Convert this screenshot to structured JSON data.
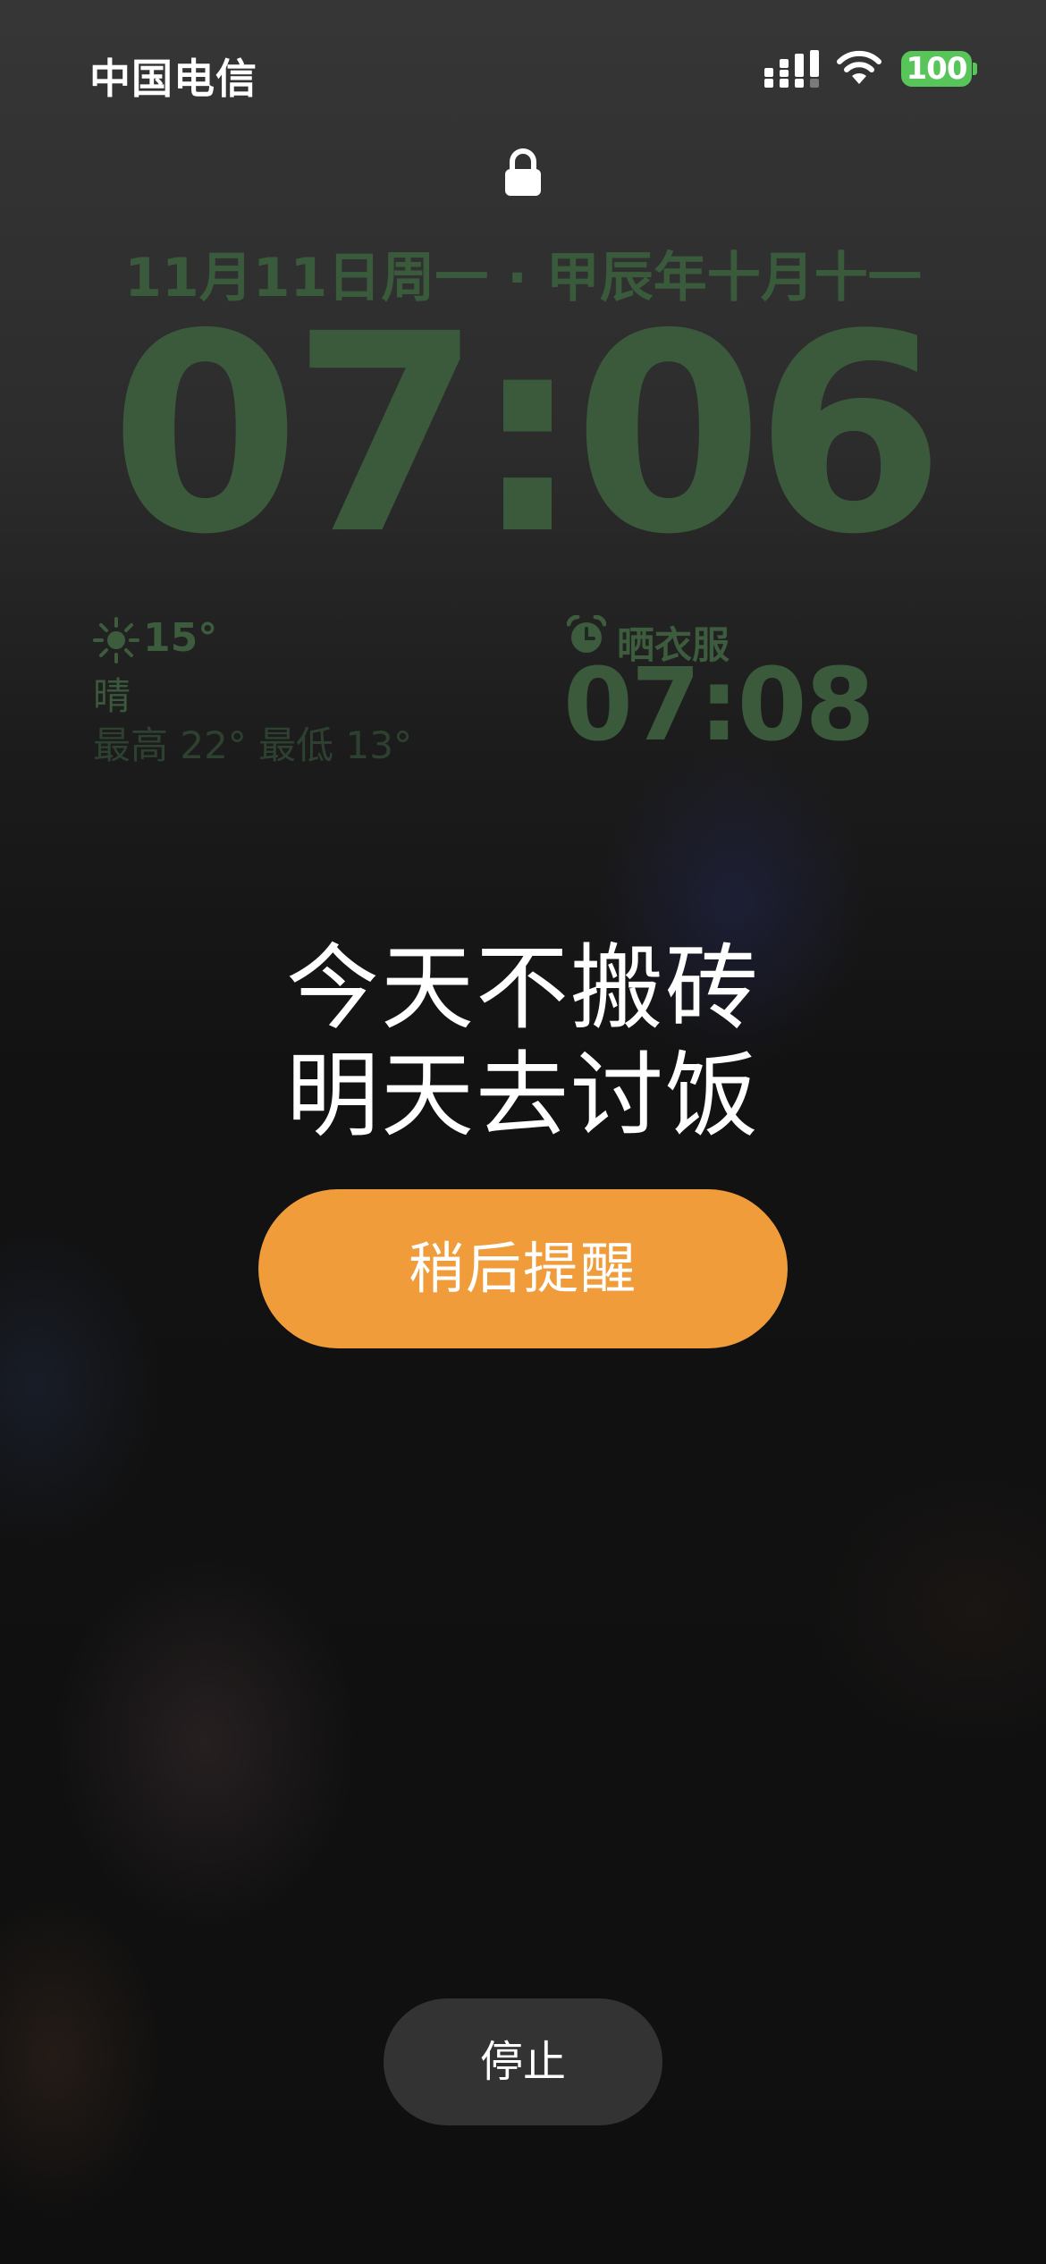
{
  "status_bar": {
    "carrier": "中国电信",
    "battery_level": "100",
    "signal_icon": "cellular-signal-icon",
    "wifi_icon": "wifi-icon",
    "battery_color": "#57c559"
  },
  "lock_screen": {
    "lock_icon": "lock-icon",
    "date": "11月11日周一 · 甲辰年十月十一",
    "time": "07:06",
    "widget_color": "#3b5a3c"
  },
  "weather_widget": {
    "icon": "sun-icon",
    "temperature": "15°",
    "condition": "晴",
    "range": "最高 22° 最低 13°"
  },
  "alarm_widget": {
    "icon": "alarm-clock-icon",
    "label": "晒衣服",
    "time": "07:08"
  },
  "alarm_alert": {
    "message_line1": "今天不搬砖",
    "message_line2": "明天去讨饭",
    "snooze_label": "稍后提醒",
    "snooze_color": "#f09c3a",
    "stop_label": "停止"
  }
}
